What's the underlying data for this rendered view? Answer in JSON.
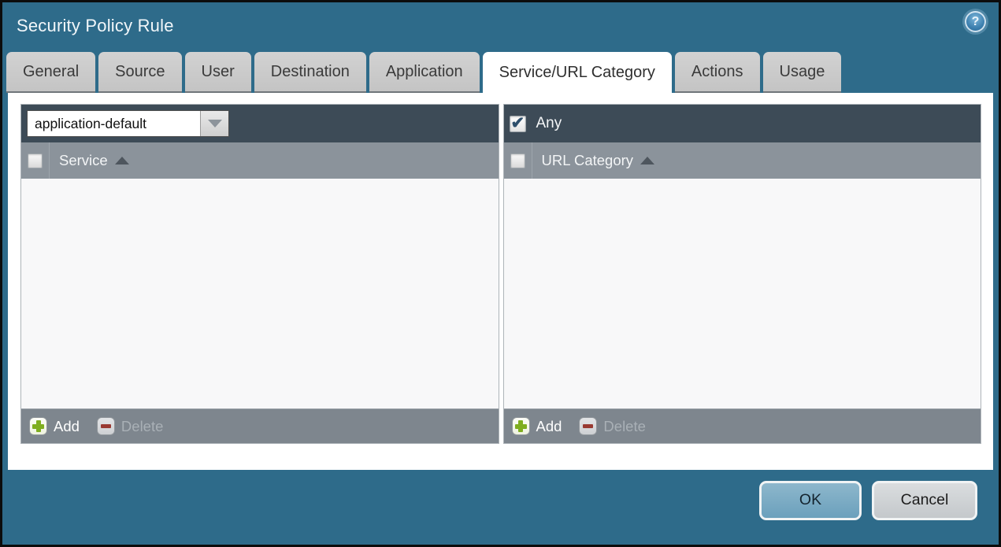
{
  "window": {
    "title": "Security Policy Rule"
  },
  "tabs": [
    {
      "label": "General",
      "active": false
    },
    {
      "label": "Source",
      "active": false
    },
    {
      "label": "User",
      "active": false
    },
    {
      "label": "Destination",
      "active": false
    },
    {
      "label": "Application",
      "active": false
    },
    {
      "label": "Service/URL Category",
      "active": true
    },
    {
      "label": "Actions",
      "active": false
    },
    {
      "label": "Usage",
      "active": false
    }
  ],
  "service_panel": {
    "dropdown_value": "application-default",
    "column_header": "Service",
    "header_checkbox_checked": false,
    "column_checkbox_checked": false,
    "add_label": "Add",
    "delete_label": "Delete",
    "delete_enabled": false,
    "rows": []
  },
  "url_category_panel": {
    "any_label": "Any",
    "any_checked": true,
    "column_header": "URL Category",
    "column_checkbox_checked": false,
    "add_label": "Add",
    "delete_label": "Delete",
    "delete_enabled": false,
    "rows": []
  },
  "dialog_buttons": {
    "ok": "OK",
    "cancel": "Cancel"
  },
  "icons": {
    "help": "?",
    "check": "✔",
    "sort_ascending": "triangle-up",
    "dropdown": "triangle-down",
    "add": "plus",
    "delete": "minus"
  },
  "colors": {
    "dialog_background": "#2e6b8a",
    "panel_header": "#3d4b57",
    "column_header": "#8b939b",
    "panel_footer": "#7e868e",
    "list_background": "#f8f8f9",
    "tab_inactive": "#c9c9c9",
    "tab_active": "#ffffff",
    "ok_button": "#74a5bf",
    "cancel_button": "#cdd0d2",
    "add_icon_green": "#7fae1f",
    "delete_icon_red": "#993a32"
  }
}
